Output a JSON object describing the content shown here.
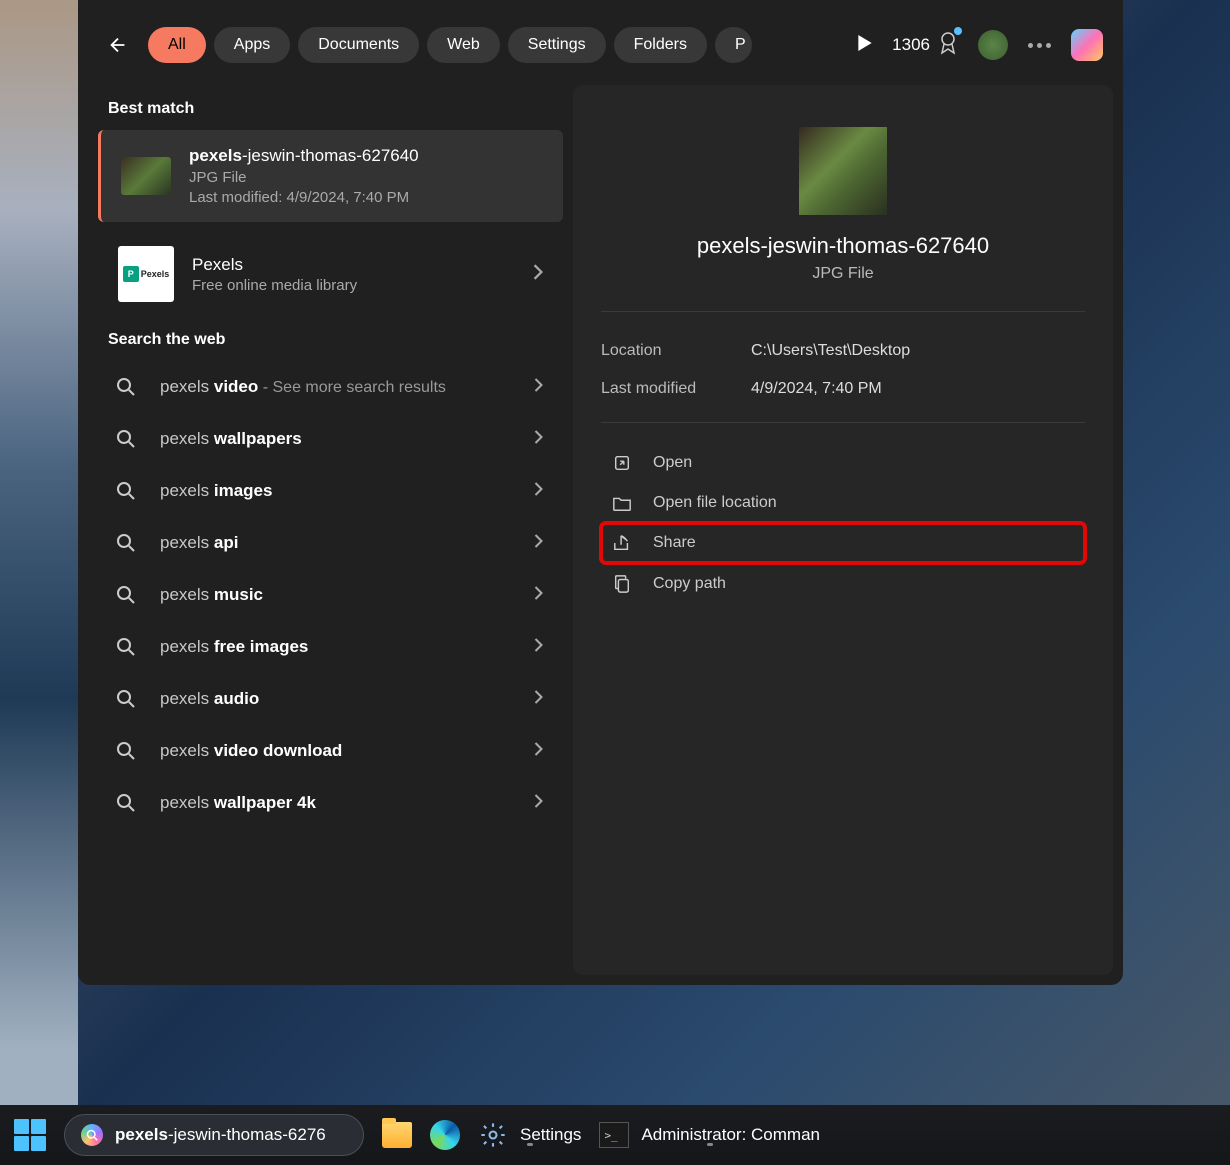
{
  "filters": {
    "all": "All",
    "apps": "Apps",
    "documents": "Documents",
    "web": "Web",
    "settings": "Settings",
    "folders": "Folders",
    "more_letter": "P"
  },
  "header": {
    "points": "1306"
  },
  "sections": {
    "best_match": "Best match",
    "search_web": "Search the web"
  },
  "best_match": {
    "title_bold": "pexels",
    "title_rest": "-jeswin-thomas-627640",
    "type": "JPG File",
    "modified": "Last modified: 4/9/2024, 7:40 PM"
  },
  "pexels": {
    "title": "Pexels",
    "subtitle": "Free online media library"
  },
  "web_results": [
    {
      "prefix": "pexels ",
      "bold": "video",
      "suffix": " - See more search results"
    },
    {
      "prefix": "pexels ",
      "bold": "wallpapers",
      "suffix": ""
    },
    {
      "prefix": "pexels ",
      "bold": "images",
      "suffix": ""
    },
    {
      "prefix": "pexels ",
      "bold": "api",
      "suffix": ""
    },
    {
      "prefix": "pexels ",
      "bold": "music",
      "suffix": ""
    },
    {
      "prefix": "pexels ",
      "bold": "free images",
      "suffix": ""
    },
    {
      "prefix": "pexels ",
      "bold": "audio",
      "suffix": ""
    },
    {
      "prefix": "pexels ",
      "bold": "video download",
      "suffix": ""
    },
    {
      "prefix": "pexels ",
      "bold": "wallpaper 4k",
      "suffix": ""
    }
  ],
  "preview": {
    "title": "pexels-jeswin-thomas-627640",
    "type": "JPG File",
    "location_label": "Location",
    "location_value": "C:\\Users\\Test\\Desktop",
    "modified_label": "Last modified",
    "modified_value": "4/9/2024, 7:40 PM"
  },
  "actions": {
    "open": "Open",
    "open_location": "Open file location",
    "share": "Share",
    "copy_path": "Copy path"
  },
  "taskbar": {
    "search_prefix": "pexels",
    "search_rest": "-jeswin-thomas-6276",
    "settings": "Settings",
    "cmd": "Administrator: Comman"
  }
}
